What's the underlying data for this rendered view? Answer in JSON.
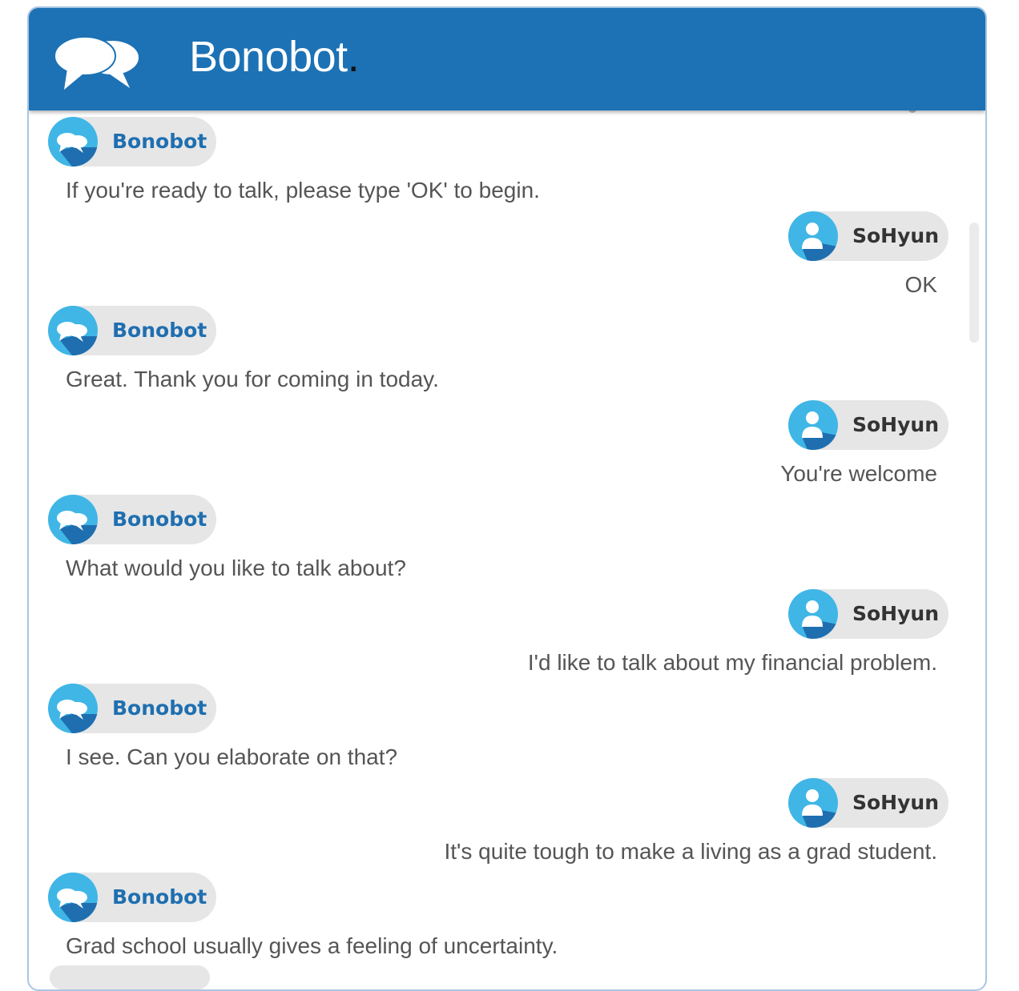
{
  "app": {
    "title": "Bonobot",
    "title_dot": ".",
    "logo_icon": "chat-bubbles-icon"
  },
  "colors": {
    "header_bg": "#1c72b5",
    "bot_name": "#1f6fb0",
    "user_name": "#333333",
    "badge_bg": "#e6e6e6",
    "message_text": "#555555"
  },
  "messages": [
    {
      "sender": "Bonobot",
      "role": "bot",
      "text": "If you're ready to talk, please type 'OK' to begin."
    },
    {
      "sender": "SoHyun",
      "role": "user",
      "text": "OK"
    },
    {
      "sender": "Bonobot",
      "role": "bot",
      "text": "Great. Thank you for coming in today."
    },
    {
      "sender": "SoHyun",
      "role": "user",
      "text": "You're welcome"
    },
    {
      "sender": "Bonobot",
      "role": "bot",
      "text": "What would you like to talk about?"
    },
    {
      "sender": "SoHyun",
      "role": "user",
      "text": "I'd like to talk about my financial problem."
    },
    {
      "sender": "Bonobot",
      "role": "bot",
      "text": "I see. Can you elaborate on that?"
    },
    {
      "sender": "SoHyun",
      "role": "user",
      "text": "It's quite tough to make a living as a grad student."
    },
    {
      "sender": "Bonobot",
      "role": "bot",
      "text": "Grad school usually gives a feeling of uncertainty."
    }
  ]
}
